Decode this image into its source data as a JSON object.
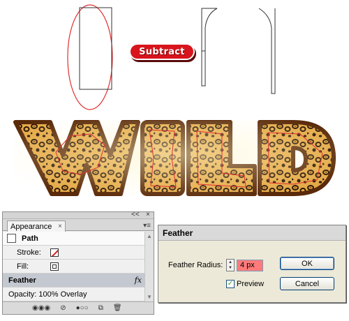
{
  "canvas": {
    "label": "Subtract",
    "word": "WILD",
    "colors": {
      "accent_red": "#d8141c",
      "outline_brown": "#5a2a0a",
      "leopard_base": "#e0a640",
      "leopard_spot": "#2a1404",
      "guide_red": "#e03030"
    }
  },
  "appearance_panel": {
    "tab_label": "Appearance",
    "tab_close": "×",
    "close_glyph": "×",
    "collapse_glyph": "<<",
    "menu_glyph": "▾≡",
    "rows": {
      "path": "Path",
      "stroke": "Stroke:",
      "fill": "Fill:",
      "feather": "Feather",
      "feather_fx": "fx",
      "opacity": "Opacity: 100% Overlay"
    },
    "toolbar": {
      "new_art_glyph": "◉◉◉",
      "clear_glyph": "⊘",
      "reduce_glyph": "●○○",
      "duplicate_glyph": "⧉",
      "delete_glyph": "🗑"
    }
  },
  "feather_dialog": {
    "title": "Feather",
    "radius_label": "Feather Radius:",
    "radius_value": "4 px",
    "preview_label": "Preview",
    "preview_checked": "✓",
    "ok_label": "OK",
    "cancel_label": "Cancel"
  }
}
